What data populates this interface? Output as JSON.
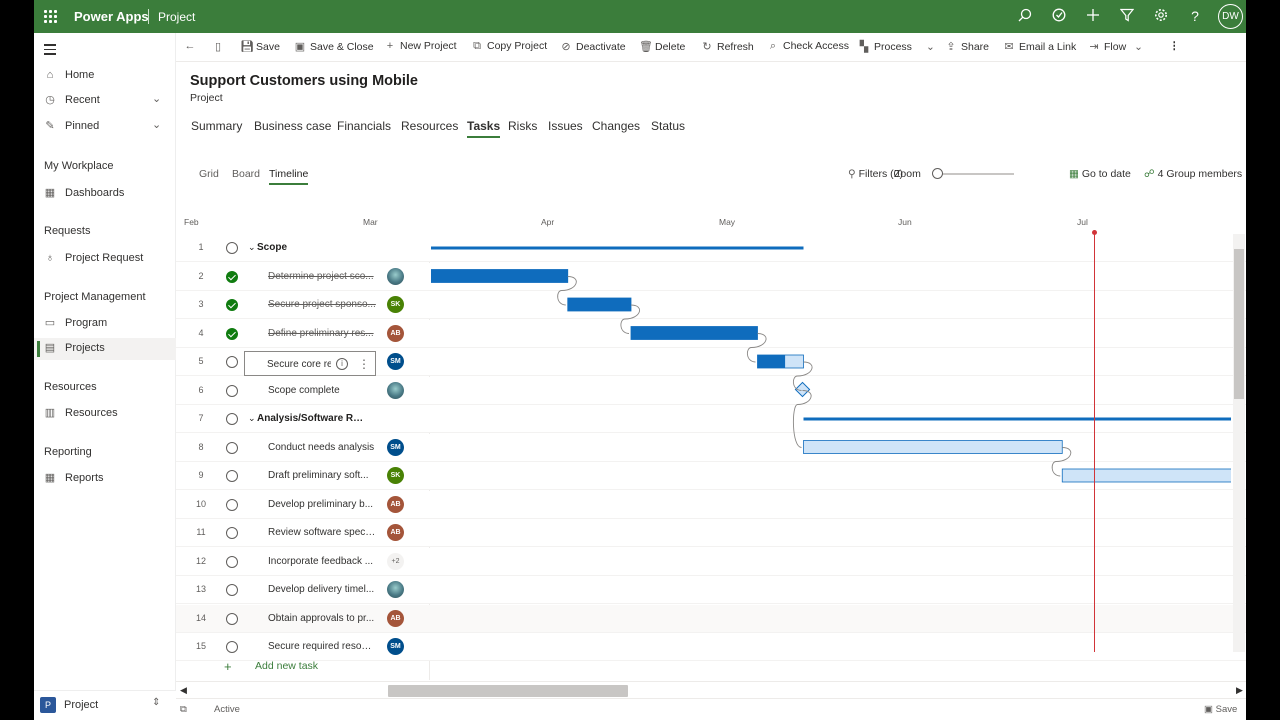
{
  "topbar": {
    "brand": "Power Apps",
    "app_name": "Project",
    "user_initials": "DW"
  },
  "command_bar": {
    "save": "Save",
    "save_close": "Save & Close",
    "new_project": "New Project",
    "copy_project": "Copy Project",
    "deactivate": "Deactivate",
    "delete": "Delete",
    "refresh": "Refresh",
    "check_access": "Check Access",
    "process": "Process",
    "share": "Share",
    "email_link": "Email a Link",
    "flow": "Flow"
  },
  "sidebar": {
    "home": "Home",
    "recent": "Recent",
    "pinned": "Pinned",
    "group_workplace": "My Workplace",
    "dashboards": "Dashboards",
    "group_requests": "Requests",
    "project_request": "Project Request",
    "group_pm": "Project Management",
    "program": "Program",
    "projects": "Projects",
    "group_resources": "Resources",
    "resources": "Resources",
    "group_reporting": "Reporting",
    "reports": "Reports",
    "area_badge": "P",
    "area_label": "Project"
  },
  "record": {
    "title": "Support Customers using Mobile",
    "entity": "Project"
  },
  "tabs": [
    "Summary",
    "Business case",
    "Financials",
    "Resources",
    "Tasks",
    "Risks",
    "Issues",
    "Changes",
    "Status"
  ],
  "views": {
    "grid": "Grid",
    "board": "Board",
    "timeline": "Timeline"
  },
  "toolbar": {
    "filters": "Filters (0)",
    "zoom": "Zoom",
    "zoom_level": 0,
    "go_to_date": "Go to date",
    "group_members": "4 Group members"
  },
  "months": [
    "Feb",
    "Mar",
    "Apr",
    "May",
    "Jun",
    "Jul"
  ],
  "tasks": [
    {
      "num": "1",
      "name": "Scope",
      "group": true,
      "done": false,
      "assignee": "",
      "avatar": "none",
      "bar": {
        "type": "summary",
        "start": "2024-02-18",
        "end": "2024-05-01"
      }
    },
    {
      "num": "2",
      "name": "Determine project sco...",
      "group": false,
      "done": true,
      "assignee": "",
      "avatar": "pic",
      "bar": {
        "type": "task",
        "start": "2024-02-18",
        "end": "2024-03-21",
        "progress": 100
      }
    },
    {
      "num": "3",
      "name": "Secure project sponso...",
      "group": false,
      "done": true,
      "assignee": "SK",
      "avatar": "#498205",
      "bar": {
        "type": "task",
        "start": "2024-03-21",
        "end": "2024-04-01",
        "progress": 100
      }
    },
    {
      "num": "4",
      "name": "Define preliminary res...",
      "group": false,
      "done": true,
      "assignee": "AB",
      "avatar": "#a4553a",
      "bar": {
        "type": "task",
        "start": "2024-04-01",
        "end": "2024-04-23",
        "progress": 100
      }
    },
    {
      "num": "5",
      "name": "Secure core resources",
      "group": false,
      "done": false,
      "assignee": "SM",
      "avatar": "#004e8c",
      "editing": true,
      "bar": {
        "type": "task",
        "start": "2024-04-23",
        "end": "2024-05-01",
        "progress": 60
      }
    },
    {
      "num": "6",
      "name": "Scope complete",
      "group": false,
      "done": false,
      "assignee": "",
      "avatar": "pic",
      "bar": {
        "type": "milestone",
        "start": "2024-05-01",
        "end": "2024-05-01"
      }
    },
    {
      "num": "7",
      "name": "Analysis/Software Req...",
      "group": true,
      "done": false,
      "assignee": "",
      "avatar": "none",
      "bar": {
        "type": "summary",
        "start": "2024-05-01",
        "end": "2024-08-31"
      }
    },
    {
      "num": "8",
      "name": "Conduct needs analysis",
      "group": false,
      "done": false,
      "assignee": "SM",
      "avatar": "#004e8c",
      "bar": {
        "type": "task",
        "start": "2024-05-01",
        "end": "2024-06-15",
        "progress": 0
      }
    },
    {
      "num": "9",
      "name": "Draft preliminary soft...",
      "group": false,
      "done": false,
      "assignee": "SK",
      "avatar": "#498205",
      "bar": {
        "type": "task",
        "start": "2024-06-15",
        "end": "2024-07-17",
        "progress": 0
      }
    },
    {
      "num": "10",
      "name": "Develop preliminary b...",
      "group": false,
      "done": false,
      "assignee": "AB",
      "avatar": "#a4553a",
      "bar": {
        "type": "task",
        "start": "2024-07-17",
        "end": "2024-07-29",
        "progress": 0
      }
    },
    {
      "num": "11",
      "name": "Review software specif...",
      "group": false,
      "done": false,
      "assignee": "AB",
      "avatar": "#a4553a",
      "bar": {
        "type": "task",
        "start": "2024-07-29",
        "end": "2024-08-10",
        "progress": 0
      }
    },
    {
      "num": "12",
      "name": "Incorporate feedback ...",
      "group": false,
      "done": false,
      "assignee": "+2",
      "avatar": "plus",
      "bar": {
        "type": "task",
        "start": "2024-08-10",
        "end": "2024-08-22",
        "progress": 0
      }
    },
    {
      "num": "13",
      "name": "Develop delivery timel...",
      "group": false,
      "done": false,
      "assignee": "",
      "avatar": "pic",
      "bar": {
        "type": "task",
        "start": "2024-08-22",
        "end": "2024-09-15",
        "progress": 0
      }
    },
    {
      "num": "14",
      "name": "Obtain approvals to pr...",
      "group": false,
      "done": false,
      "assignee": "AB",
      "avatar": "#a4553a",
      "bar": null
    },
    {
      "num": "15",
      "name": "Secure required resour...",
      "group": false,
      "done": false,
      "assignee": "SM",
      "avatar": "#004e8c",
      "bar": null
    }
  ],
  "add_task": "Add new task",
  "statusbar": {
    "state": "Active",
    "save": "Save"
  }
}
